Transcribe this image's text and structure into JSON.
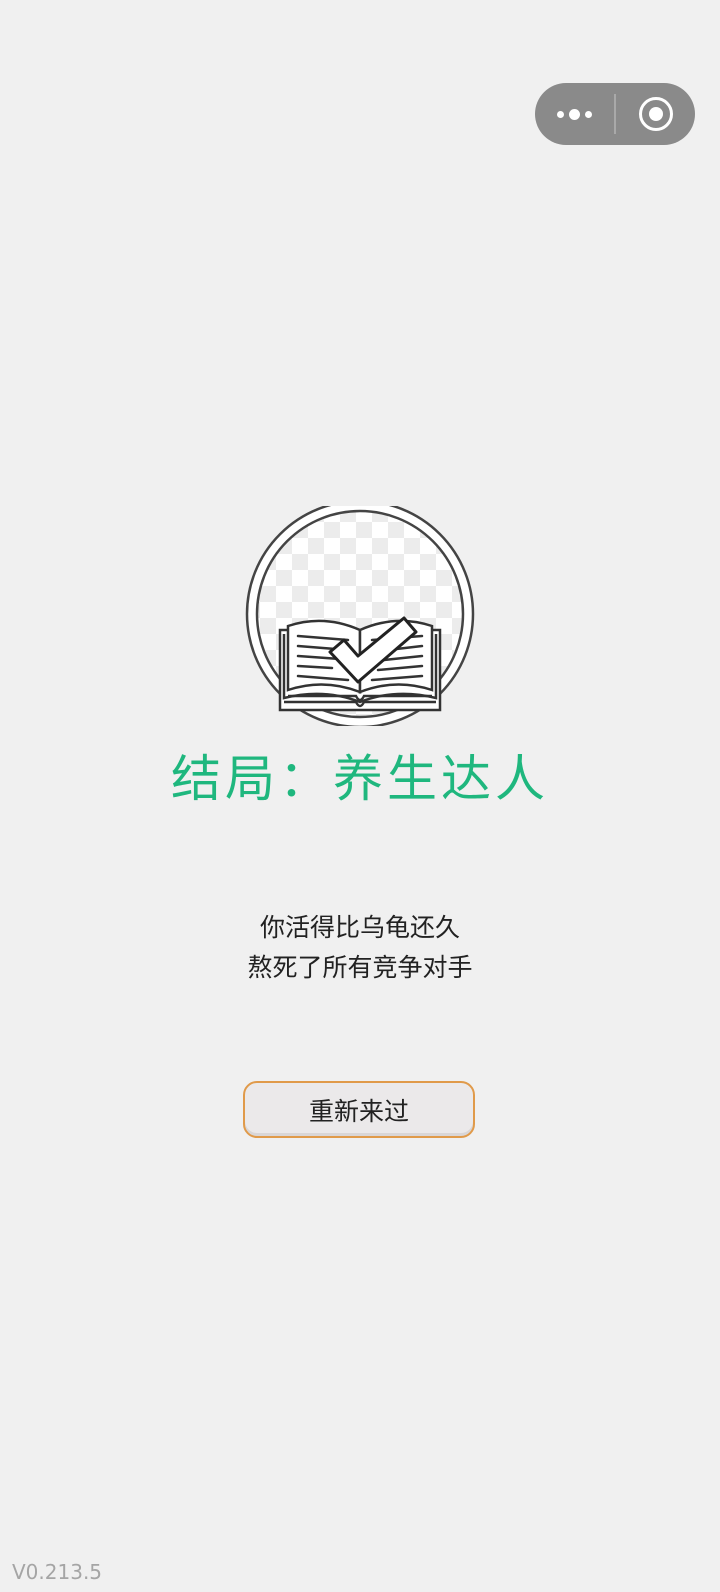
{
  "capsule": {
    "menu_icon": "more-dots-icon",
    "close_icon": "target-icon"
  },
  "ending": {
    "emblem_icon": "book-check-icon",
    "title": "结局：养生达人",
    "title_color": "#1fb77e",
    "description_lines": [
      "你活得比乌龟还久",
      "熬死了所有竞争对手"
    ]
  },
  "retry_button": {
    "label": "重新来过",
    "border_color": "#e09a4a"
  },
  "version": "V0.213.5"
}
